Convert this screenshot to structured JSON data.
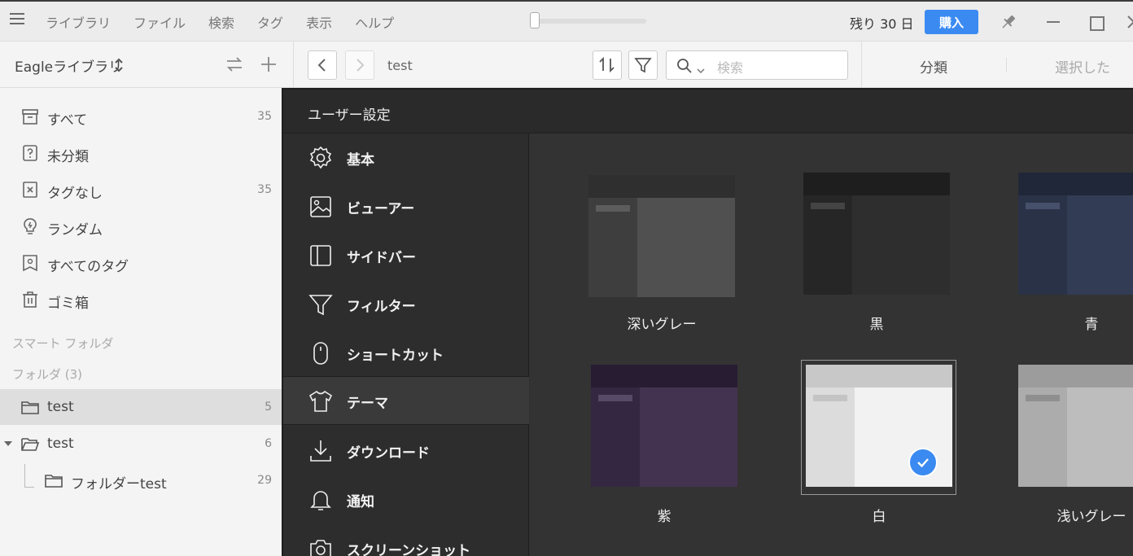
{
  "titlebar": {
    "menu": [
      "ライブラリ",
      "ファイル",
      "検索",
      "タグ",
      "表示",
      "ヘルプ"
    ],
    "trial_text": "残り 30 日",
    "buy_label": "購入"
  },
  "toolbar": {
    "library_name": "Eagleライブラリ",
    "breadcrumb": "test",
    "search_placeholder": "検索",
    "tab_classify": "分類",
    "tab_selected": "選択した"
  },
  "sidebar": {
    "items": [
      {
        "label": "すべて",
        "count": "35"
      },
      {
        "label": "未分類",
        "count": ""
      },
      {
        "label": "タグなし",
        "count": "35"
      },
      {
        "label": "ランダム",
        "count": ""
      },
      {
        "label": "すべてのタグ",
        "count": ""
      },
      {
        "label": "ゴミ箱",
        "count": ""
      }
    ],
    "smart_folder_heading": "スマート フォルダ",
    "folder_heading": "フォルダ (3)",
    "folders": [
      {
        "label": "test",
        "count": "5"
      },
      {
        "label": "test",
        "count": "6"
      },
      {
        "label": "フォルダーtest",
        "count": "29"
      }
    ]
  },
  "settings": {
    "title": "ユーザー設定",
    "nav": [
      {
        "label": "基本",
        "icon": "gear-icon"
      },
      {
        "label": "ビューアー",
        "icon": "image-icon"
      },
      {
        "label": "サイドバー",
        "icon": "sidebar-icon"
      },
      {
        "label": "フィルター",
        "icon": "filter-icon"
      },
      {
        "label": "ショートカット",
        "icon": "mouse-icon"
      },
      {
        "label": "テーマ",
        "icon": "shirt-icon"
      },
      {
        "label": "ダウンロード",
        "icon": "download-icon"
      },
      {
        "label": "通知",
        "icon": "bell-icon"
      },
      {
        "label": "スクリーンショット",
        "icon": "camera-icon"
      }
    ],
    "active_nav": "テーマ",
    "themes": [
      {
        "label": "深いグレー",
        "colors": {
          "head": "#2f2f2f",
          "side": "#3e3e3e",
          "main": "#505050",
          "bar": "#5c5c5c"
        }
      },
      {
        "label": "黒",
        "colors": {
          "head": "#1e1e1e",
          "side": "#262626",
          "main": "#2e2e2e",
          "bar": "#444444"
        }
      },
      {
        "label": "青",
        "colors": {
          "head": "#202738",
          "side": "#2a3247",
          "main": "#323c55",
          "bar": "#46506a"
        }
      },
      {
        "label": "紫",
        "colors": {
          "head": "#281c33",
          "side": "#342741",
          "main": "#433350",
          "bar": "#574a66"
        }
      },
      {
        "label": "白",
        "colors": {
          "head": "#c8c8c8",
          "side": "#dcdcdc",
          "main": "#f2f2f2",
          "bar": "#c4c4c4"
        },
        "selected": true
      },
      {
        "label": "浅いグレー",
        "colors": {
          "head": "#9c9c9c",
          "side": "#acacac",
          "main": "#bdbdbd",
          "bar": "#8f8f8f"
        }
      }
    ],
    "accent": "#3b8af1"
  }
}
